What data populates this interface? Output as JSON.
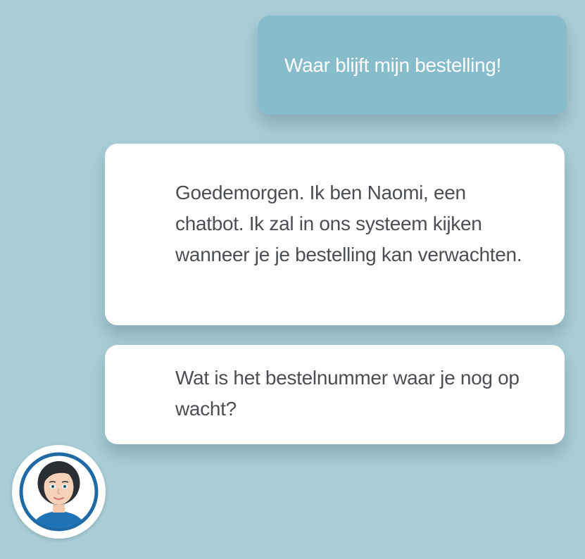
{
  "messages": [
    {
      "sender": "user",
      "text": "Waar blijft mijn bestelling!"
    },
    {
      "sender": "bot",
      "text": "Goedemorgen. Ik ben Naomi, een chatbot. Ik zal in ons systeem kijken wanneer je je bestelling kan verwachten."
    },
    {
      "sender": "bot",
      "text": "Wat is het bestelnummer waar je nog op wacht?"
    }
  ],
  "colors": {
    "background": "#a8cdd6",
    "user_bubble": "#87bccb",
    "bot_bubble": "#ffffff",
    "avatar_ring": "#1f6aa5"
  },
  "avatar": {
    "icon": "bot-avatar-icon"
  }
}
